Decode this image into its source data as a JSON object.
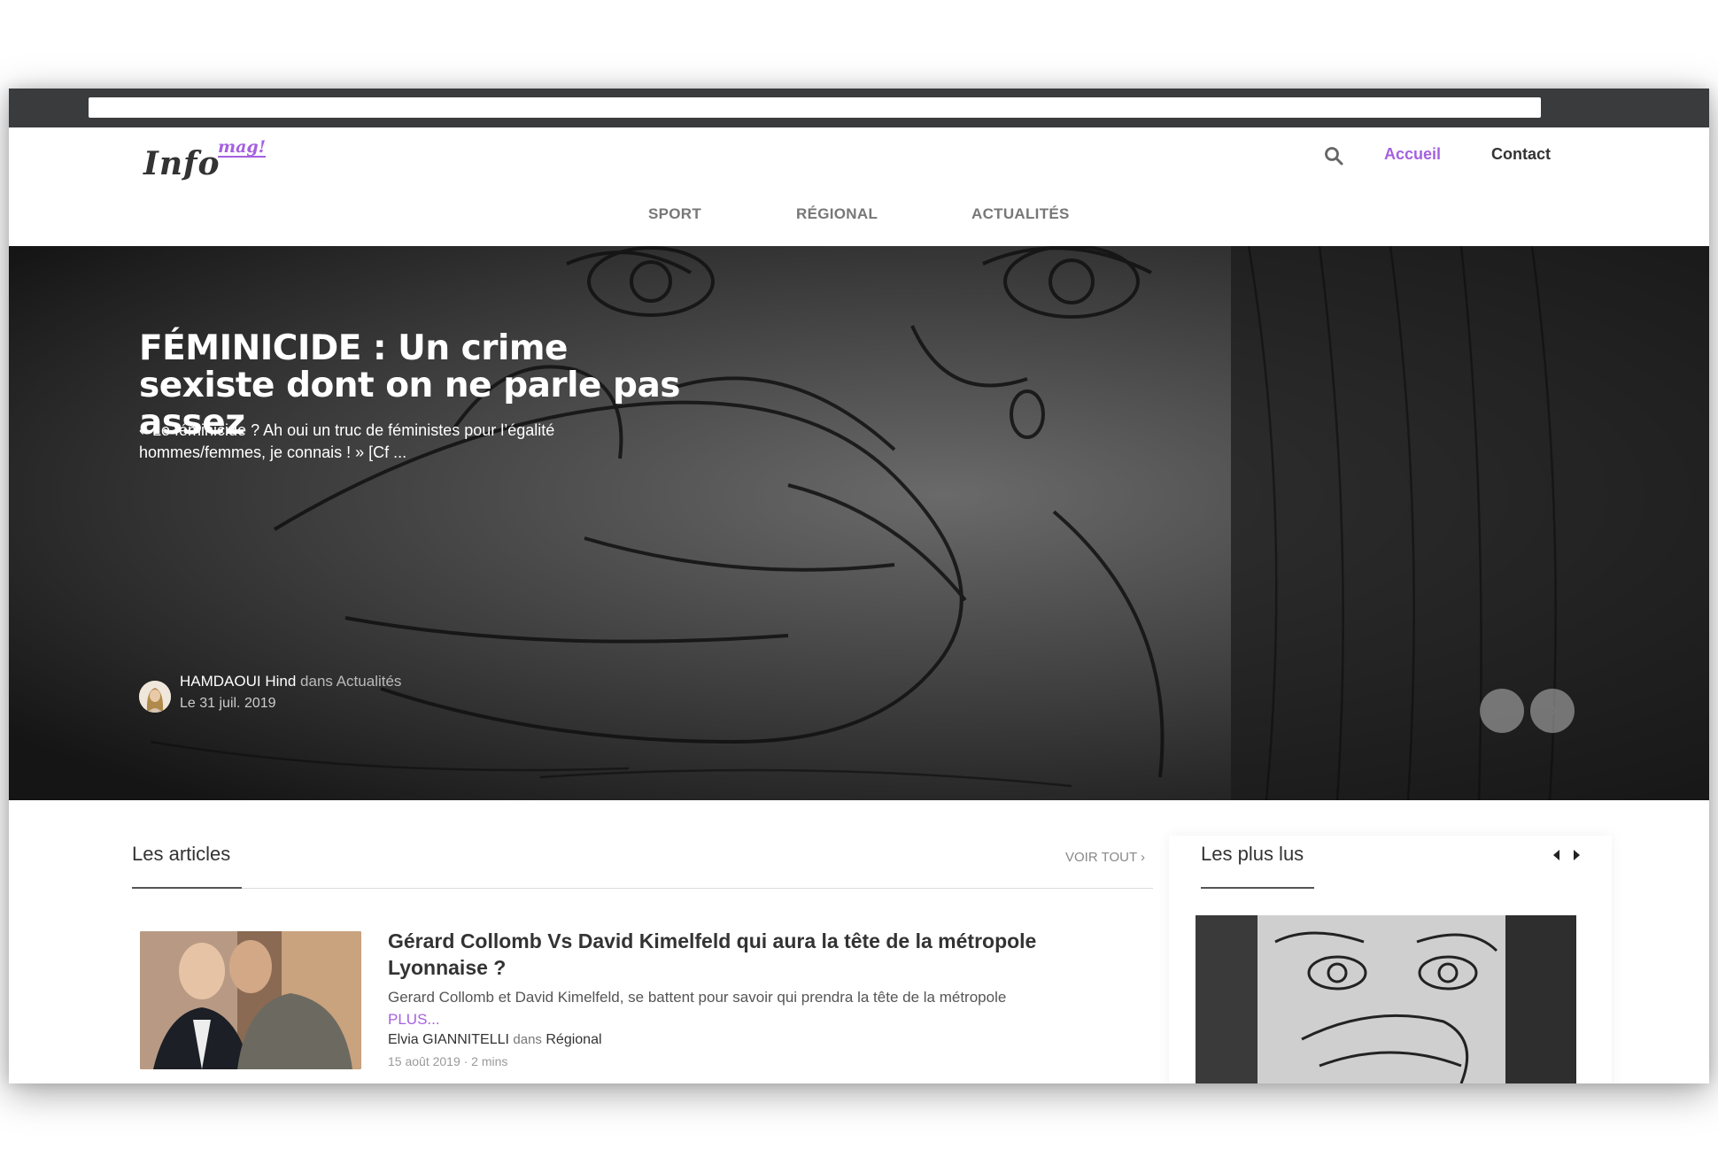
{
  "header": {
    "logo_text": "Info",
    "logo_sup": "mag!",
    "nav": {
      "accueil": "Accueil",
      "contact": "Contact"
    },
    "categories": [
      "SPORT",
      "RÉGIONAL",
      "ACTUALITÉS"
    ]
  },
  "hero": {
    "title": "FÉMINICIDE : Un crime sexiste dont on ne parle pas assez",
    "excerpt": "« Le féminicide ? Ah oui un truc de féministes pour l’égalité hommes/femmes, je connais ! » [Cf ...",
    "author": "HAMDAOUI Hind",
    "dans": "dans",
    "category": "Actualités",
    "date": "Le 31 juil. 2019"
  },
  "articles": {
    "title": "Les articles",
    "voir_tout": "VOIR TOUT ›",
    "items": [
      {
        "title": "Gérard Collomb Vs David Kimelfeld qui aura la tête de la métropole Lyonnaise ?",
        "excerpt": "Gerard Collomb et David Kimelfeld, se battent pour savoir qui prendra la tête de la métropole",
        "more": "PLUS...",
        "author": "Elvia GIANNITELLI",
        "dans": "dans",
        "category": "Régional",
        "date": "15 août 2019 · 2 mins"
      }
    ]
  },
  "plus_lus": {
    "title": "Les plus lus"
  },
  "icons": [
    "search-icon",
    "chevron-left-icon",
    "chevron-right-icon",
    "caret-left-icon",
    "caret-right-icon"
  ],
  "colors": {
    "accent": "#a561e0",
    "browser_bar": "#3a3b3d",
    "text_dark": "#333333"
  }
}
